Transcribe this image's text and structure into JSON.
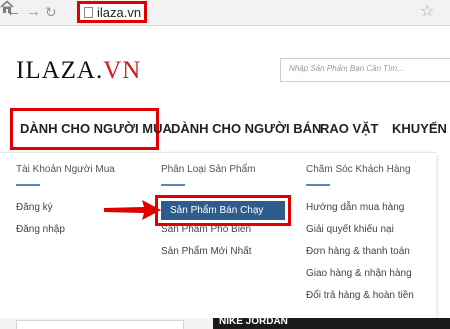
{
  "browser": {
    "url": "ilaza.vn",
    "back_icon": "back-arrow-icon",
    "forward_icon": "forward-arrow-icon",
    "reload_icon": "reload-icon",
    "home_icon": "home-icon",
    "bookmark_icon": "star-icon"
  },
  "header": {
    "logo_part1": "ILAZA.",
    "logo_part2": "VN",
    "search_placeholder": "Nhập Sản Phẩm Bạn Cần Tìm..."
  },
  "nav": {
    "items": [
      {
        "label": "DÀNH CHO NGƯỜI MUA",
        "active": true
      },
      {
        "label": "DÀNH CHO NGƯỜI BÁN",
        "active": false
      },
      {
        "label": "RAO VẶT",
        "active": false
      },
      {
        "label": "KHUYẾN MÃ",
        "active": false
      }
    ]
  },
  "dropdown": {
    "columns": [
      {
        "title": "Tài Khoản Người Mua",
        "links": [
          "Đăng ký",
          "Đăng nhập"
        ]
      },
      {
        "title": "Phân Loại Sản Phẩm",
        "links": [
          "Sản Phẩm Bán Chạy",
          "Sản Phẩm Phổ Biến",
          "Sản Phẩm Mới Nhất"
        ]
      },
      {
        "title": "Chăm Sóc Khách Hàng",
        "links": [
          "Hướng dẫn mua hàng",
          "Giải quyết khiếu nại",
          "Đơn hàng & thanh toán",
          "Giao hàng & nhận hàng",
          "Đổi trả hàng & hoàn tiền"
        ]
      }
    ],
    "highlighted": "Sản Phẩm Bán Chạy"
  },
  "banner": {
    "text": "NIKE JORDAN"
  },
  "colors": {
    "accent_red": "#e00000",
    "logo_red": "#cc1b1b",
    "highlight_blue": "#2e5c8c"
  }
}
